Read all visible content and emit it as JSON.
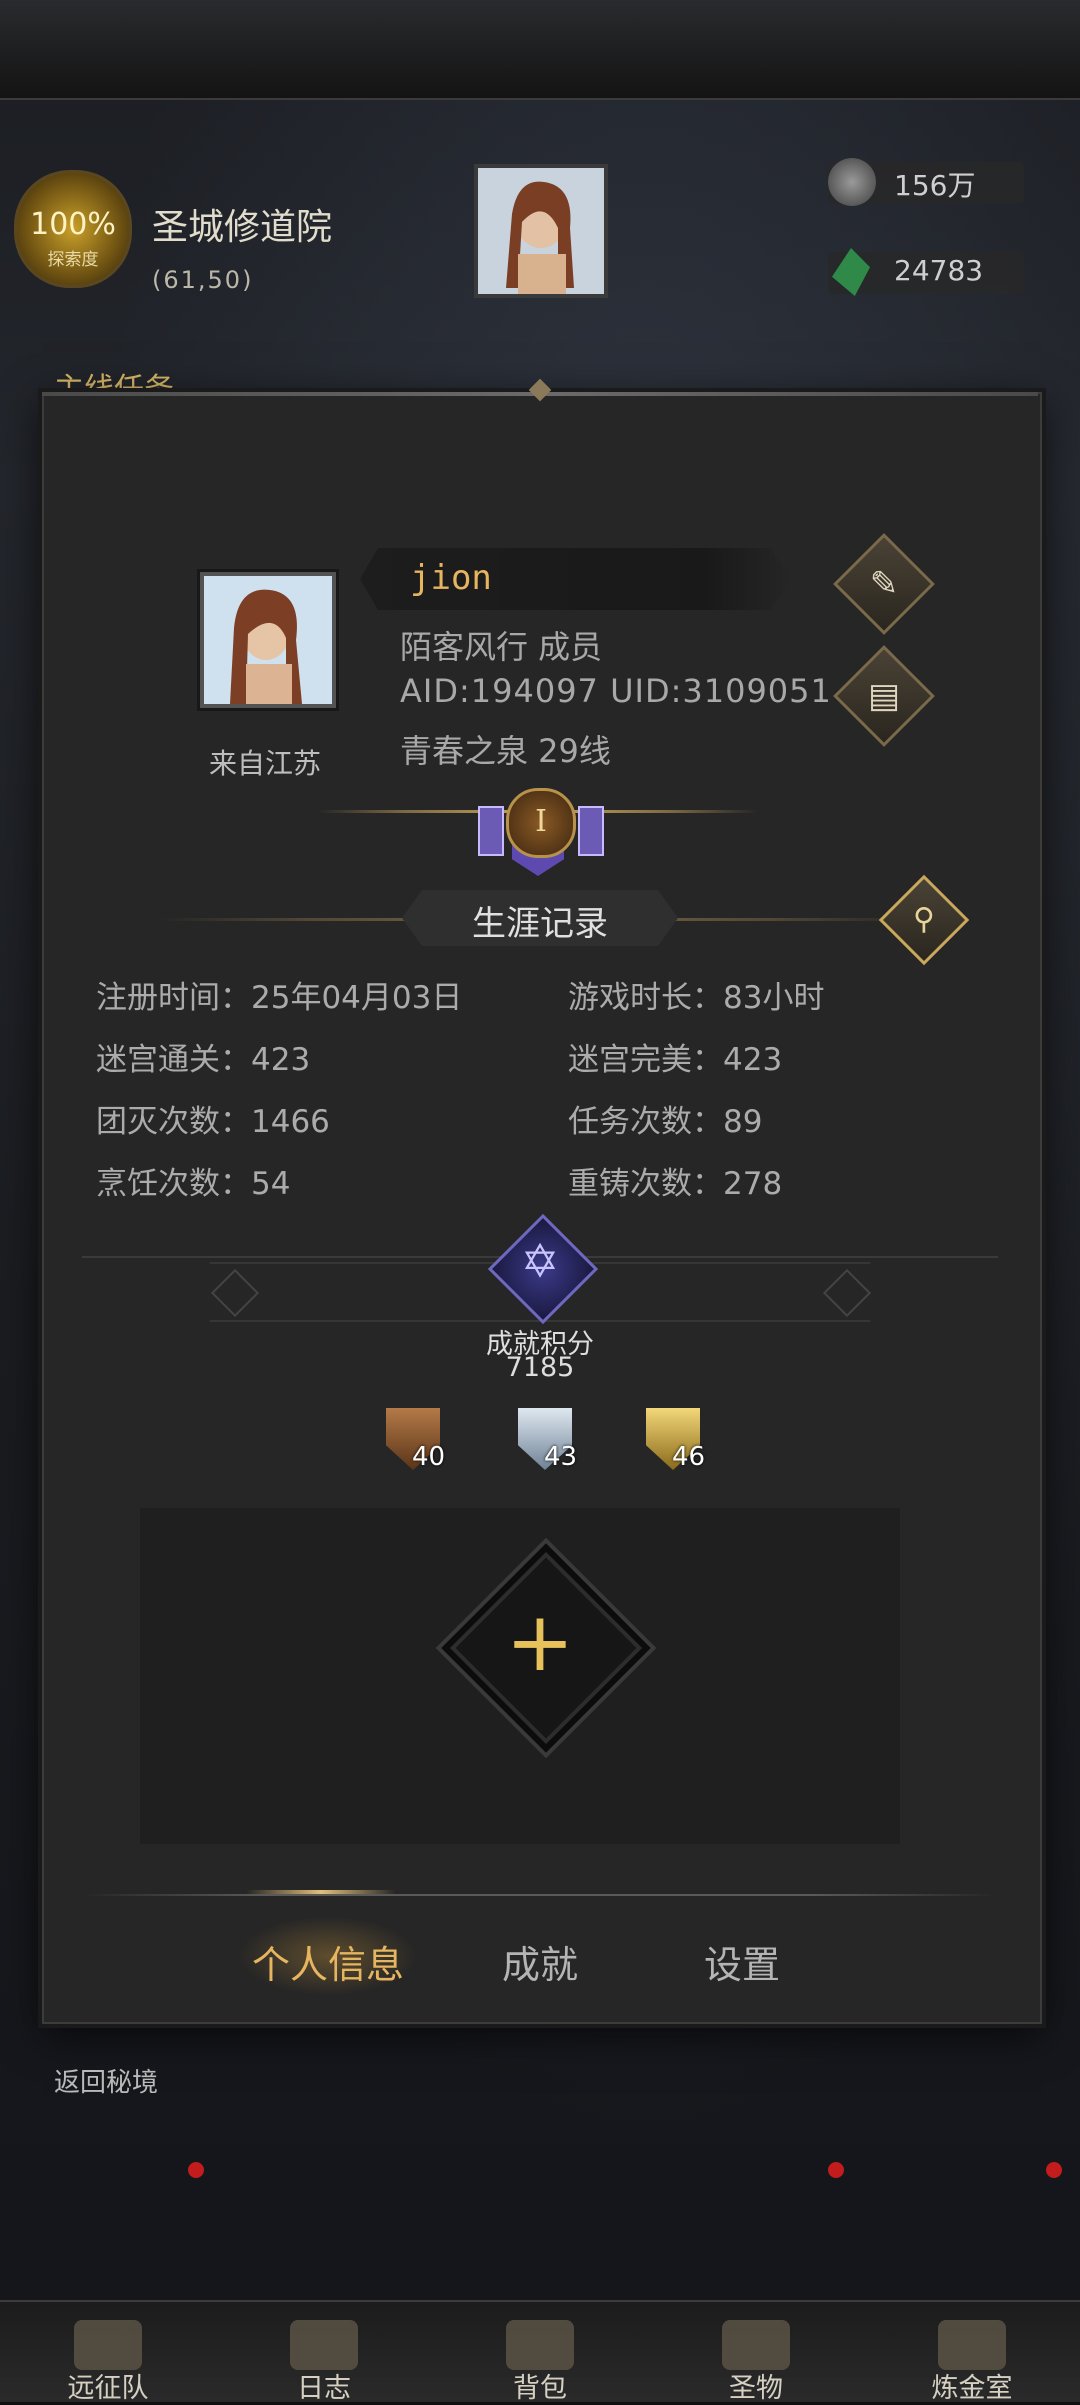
{
  "hud": {
    "exploration_percent": "100%",
    "exploration_label": "探索度",
    "location_name": "圣城修道院",
    "location_coords": "(61,50)",
    "resources": [
      {
        "icon": "silver-coin-icon",
        "value": "156万"
      },
      {
        "icon": "green-gem-icon",
        "value": "24783"
      }
    ],
    "main_quest_label": "主线任务"
  },
  "profile": {
    "player_name": "jion",
    "guild_line": "陌客风行  成员",
    "ids_line": "AID:194097 UID:3109051",
    "server_line": "青春之泉  29线",
    "hometown": "来自江苏",
    "rank_numeral": "I"
  },
  "career": {
    "title": "生涯记录",
    "stats_left": [
      "注册时间：25年04月03日",
      "迷宫通关：423",
      "团灭次数：1466",
      "烹饪次数：54"
    ],
    "stats_right": [
      "游戏时长：83小时",
      "迷宫完美：423",
      "任务次数：89",
      "重铸次数：278"
    ]
  },
  "achievement": {
    "label": "成就积分",
    "score": "7185",
    "badges": [
      {
        "tier": "bronze",
        "count": "40"
      },
      {
        "tier": "silver",
        "count": "43"
      },
      {
        "tier": "gold",
        "count": "46"
      }
    ]
  },
  "tabs": [
    {
      "label": "个人信息",
      "active": true
    },
    {
      "label": "成就",
      "active": false
    },
    {
      "label": "设置",
      "active": false
    }
  ],
  "return_label": "返回秘境",
  "bottom_nav": [
    {
      "label": "远征队",
      "icon": "helmet-icon"
    },
    {
      "label": "日志",
      "icon": "journal-icon"
    },
    {
      "label": "背包",
      "icon": "backpack-icon"
    },
    {
      "label": "圣物",
      "icon": "relic-icon"
    },
    {
      "label": "炼金室",
      "icon": "alchemy-icon"
    }
  ],
  "colors": {
    "accent_gold": "#e6b55f",
    "text_gray": "#ababab",
    "panel_bg": "#262626",
    "badge_bronze": "#8a5a30",
    "badge_silver": "#9fb0c0",
    "badge_gold": "#c9a23a",
    "notify_red": "#c21c1c"
  }
}
